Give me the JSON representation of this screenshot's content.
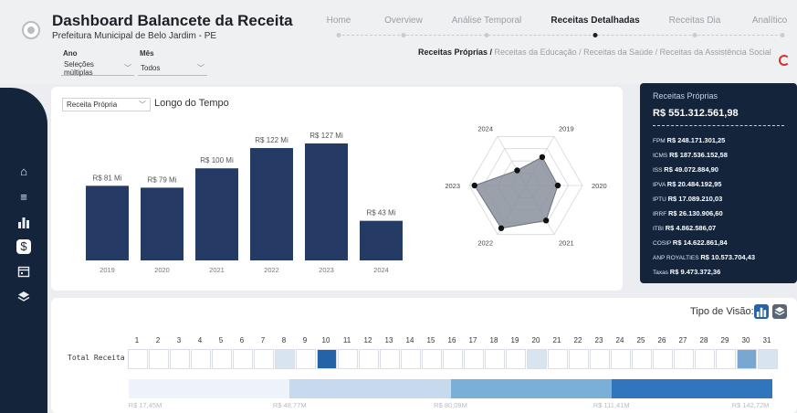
{
  "header": {
    "title": "Dashboard Balancete da Receita",
    "subtitle": "Prefeitura Municipal de Belo Jardim - PE",
    "filters": [
      {
        "label": "Ano",
        "value": "Seleções múltiplas"
      },
      {
        "label": "Mês",
        "value": "Todos"
      }
    ],
    "nav": [
      {
        "label": "Home",
        "active": false
      },
      {
        "label": "Overview",
        "active": false
      },
      {
        "label": "Análise Temporal",
        "active": false
      },
      {
        "label": "Receitas Detalhadas",
        "active": true
      },
      {
        "label": "Receitas Dia",
        "active": false
      },
      {
        "label": "Analítico",
        "active": false
      }
    ],
    "sub_tabs": {
      "active": "Receitas Próprias /",
      "rest": " Receitas da Educação / Receitas da Saúde / Receitas da Assistência Social"
    }
  },
  "sidebar": {
    "icons": [
      "home-icon",
      "list-icon",
      "bar-chart-icon",
      "money-icon",
      "calendar-icon",
      "layers-icon"
    ],
    "active": "money-icon"
  },
  "chart_card": {
    "select_value": "Receita Própria",
    "title": "Longo do Tempo"
  },
  "chart_data": [
    {
      "type": "bar",
      "categories": [
        "2019",
        "2020",
        "2021",
        "2022",
        "2023",
        "2024"
      ],
      "values": [
        81,
        79,
        100,
        122,
        127,
        43
      ],
      "data_labels": [
        "R$ 81 Mi",
        "R$ 79 Mi",
        "R$ 100 Mi",
        "R$ 122 Mi",
        "R$ 127 Mi",
        "R$ 43 Mi"
      ],
      "ylim": [
        0,
        127
      ],
      "color": "#253b66"
    },
    {
      "type": "radar",
      "axes": [
        "2019",
        "2020",
        "2021",
        "2022",
        "2023",
        "2024"
      ],
      "values": [
        81,
        79,
        100,
        122,
        127,
        43
      ],
      "rmax": 140,
      "rings": 4
    },
    {
      "type": "heatmap",
      "row_label": "Total Receita",
      "columns": [
        "1",
        "2",
        "3",
        "4",
        "5",
        "6",
        "7",
        "8",
        "9",
        "10",
        "11",
        "12",
        "13",
        "14",
        "15",
        "16",
        "17",
        "18",
        "19",
        "20",
        "21",
        "22",
        "23",
        "24",
        "25",
        "26",
        "27",
        "28",
        "29",
        "30",
        "31"
      ],
      "highlight": {
        "8": "#d9e4f1",
        "10": "#2563a8",
        "20": "#d9e4f1",
        "30": "#7aa7d2",
        "31": "#d9e4f1"
      },
      "color_scale": {
        "stops": [
          "R$ 17,45M",
          "R$ 48,77M",
          "R$ 80,09M",
          "R$ 111,41M",
          "R$ 142,72M"
        ],
        "colors": [
          "#eef2fa",
          "#c7d9ec",
          "#7aafd8",
          "#2f76be"
        ]
      }
    }
  ],
  "panel": {
    "title": "Receitas Próprias",
    "total": "R$ 551.312.561,98",
    "items": [
      {
        "key": "FPM",
        "value": "R$ 248.171.301,25"
      },
      {
        "key": "ICMS",
        "value": "R$ 187.536.152,58"
      },
      {
        "key": "ISS",
        "value": "R$ 49.072.884,90"
      },
      {
        "key": "IPVA",
        "value": "R$ 20.484.192,95"
      },
      {
        "key": "IPTU",
        "value": "R$ 17.089.210,03"
      },
      {
        "key": "IRRF",
        "value": "R$ 26.130.906,60"
      },
      {
        "key": "ITBI",
        "value": "R$ 4.862.586,07"
      },
      {
        "key": "COSIP",
        "value": "R$ 14.622.861,84"
      },
      {
        "key": "ANP ROYALTIES",
        "value": "R$ 10.573.704,43"
      },
      {
        "key": "Taxas",
        "value": "R$ 9.473.372,36"
      }
    ]
  },
  "bottom": {
    "tipo_label": "Tipo de Visão:",
    "vis_buttons": [
      {
        "icon": "bar-chart-icon",
        "active": true
      },
      {
        "icon": "layers-icon",
        "active": false
      }
    ]
  },
  "colors": {
    "navy": "#14243b",
    "bar": "#253b66",
    "accent_red": "#e02a2a"
  }
}
